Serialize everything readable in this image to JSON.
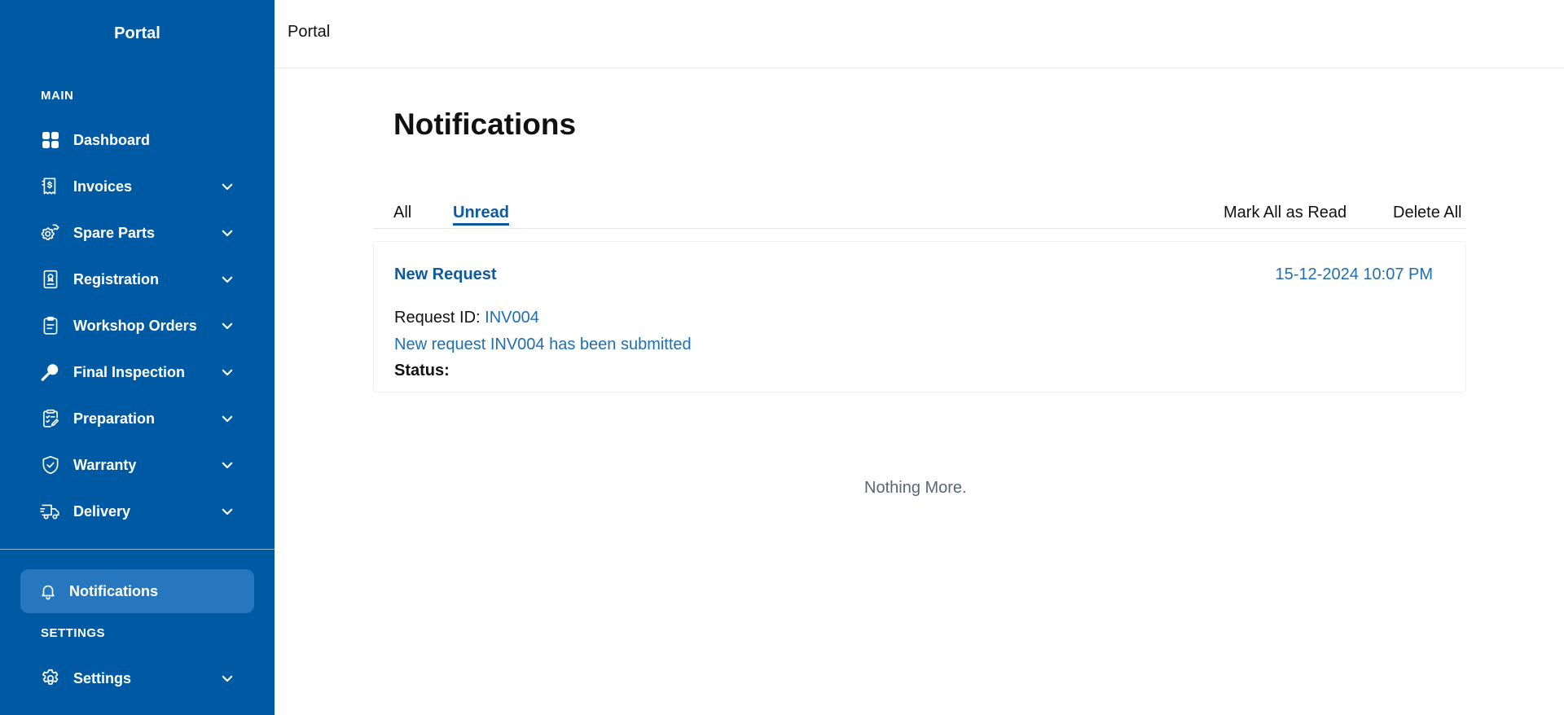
{
  "sidebar": {
    "brand": "Portal",
    "main_label": "MAIN",
    "settings_label": "SETTINGS",
    "items": [
      {
        "label": "Dashboard",
        "icon": "dashboard-icon"
      },
      {
        "label": "Invoices",
        "icon": "invoice-icon"
      },
      {
        "label": "Spare Parts",
        "icon": "spare-parts-icon"
      },
      {
        "label": "Registration",
        "icon": "registration-icon"
      },
      {
        "label": "Workshop Orders",
        "icon": "clipboard-icon"
      },
      {
        "label": "Final Inspection",
        "icon": "inspection-icon"
      },
      {
        "label": "Preparation",
        "icon": "checklist-icon"
      },
      {
        "label": "Warranty",
        "icon": "shield-check-icon"
      },
      {
        "label": "Delivery",
        "icon": "truck-icon"
      }
    ],
    "notifications": {
      "label": "Notifications",
      "icon": "bell-icon"
    },
    "settings": {
      "label": "Settings",
      "icon": "gear-icon"
    }
  },
  "header": {
    "title": "Portal"
  },
  "main": {
    "title": "Notifications",
    "tabs": [
      {
        "label": "All",
        "active": false
      },
      {
        "label": "Unread",
        "active": true
      }
    ],
    "actions": {
      "mark_all": "Mark All as Read",
      "delete_all": "Delete All"
    },
    "notifications": [
      {
        "title": "New Request",
        "timestamp": "15-12-2024 10:07 PM",
        "request_id_label": "Request ID:",
        "request_id": "INV004",
        "message": "New request INV004 has been submitted",
        "status_label": "Status:"
      }
    ],
    "empty_message": "Nothing More."
  },
  "colors": {
    "sidebar_bg": "#0059a3",
    "active_item_bg": "#2677bd",
    "accent": "#0d5aa0"
  }
}
